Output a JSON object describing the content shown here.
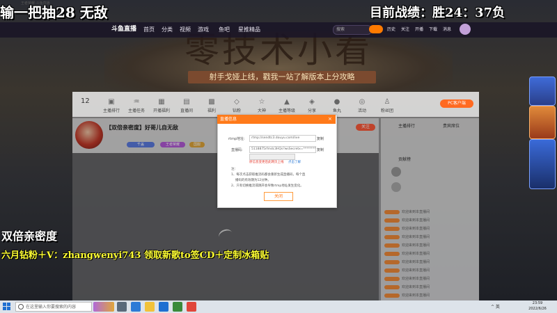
{
  "window": {
    "title": "王者荣耀·斗鱼直播"
  },
  "overlays": {
    "top_left": "输一把抽28 无敌",
    "top_right": "目前战绩：胜24：37负",
    "mid_title": "双倍亲密度",
    "mid_promo": "六月钻粉＋V：zhangwenyi743 领取新歌to签CD＋定制冰箱贴"
  },
  "site_nav": {
    "logo": "斗鱼直播",
    "items": [
      "首页",
      "分类",
      "视频",
      "游戏",
      "鱼吧",
      "星推精品"
    ],
    "search_placeholder": "搜索",
    "right_items": [
      "历史",
      "关注",
      "开播",
      "下载",
      "消息"
    ]
  },
  "banner": {
    "title": "零技术小看",
    "subtitle": "射手戈娅上线，戳我一站了解版本上分攻略"
  },
  "icon_bar": {
    "score": "12",
    "items": [
      "主播排行",
      "主播任务",
      "开播福利",
      "直播间",
      "福利",
      "钻粉",
      "大神",
      "主播等级",
      "分享",
      "鱼丸",
      "活动",
      "粉丝团"
    ],
    "pc_button": "PC客户端"
  },
  "room": {
    "title": "【双倍亲密度】好哥儿自无敌",
    "tags": [
      "千盖",
      "王者荣耀",
      "国服"
    ],
    "follow": "关注"
  },
  "chat": {
    "tab_a": "主播排行",
    "tab_b": "贵宾席位",
    "gift_title": "贡献榜",
    "lines": [
      "欢迎来到本直播间",
      "欢迎来到本直播间",
      "欢迎来到本直播间",
      "欢迎来到本直播间",
      "欢迎来到本直播间",
      "欢迎来到本直播间",
      "欢迎来到本直播间",
      "欢迎来到本直播间",
      "欢迎来到本直播间",
      "欢迎来到本直播间",
      "欢迎来到本直播间",
      "欢迎来到本直播间"
    ]
  },
  "dialog": {
    "title": "直播信息",
    "close": "×",
    "rtmp_label": "rtmp地址:",
    "rtmp_value": "rtmp://sendtc3.douyu.com/live",
    "code_label": "直播码:",
    "code_value": "5118875rfmdc3HQs?wsSecretx=********",
    "copy": "复制",
    "red_text": "原信息变更后此网页上线",
    "link_text": "点击了解",
    "note_head": "注：",
    "notes": [
      "1、每次点击获取推流码都会重新生成直播码，每个直",
      "播码的有效期为12分钟。",
      "2、只有切换推流或跳开会导致rtmp地址发生变化。"
    ],
    "ok": "关闭"
  },
  "taskbar": {
    "search_placeholder": "在这里输入你要搜索的内容",
    "clock_time": "23:59",
    "clock_date": "2022/6/26",
    "tray": "^  英"
  },
  "colors": {
    "accent": "#ff7a1a",
    "promo": "#ffff33"
  }
}
